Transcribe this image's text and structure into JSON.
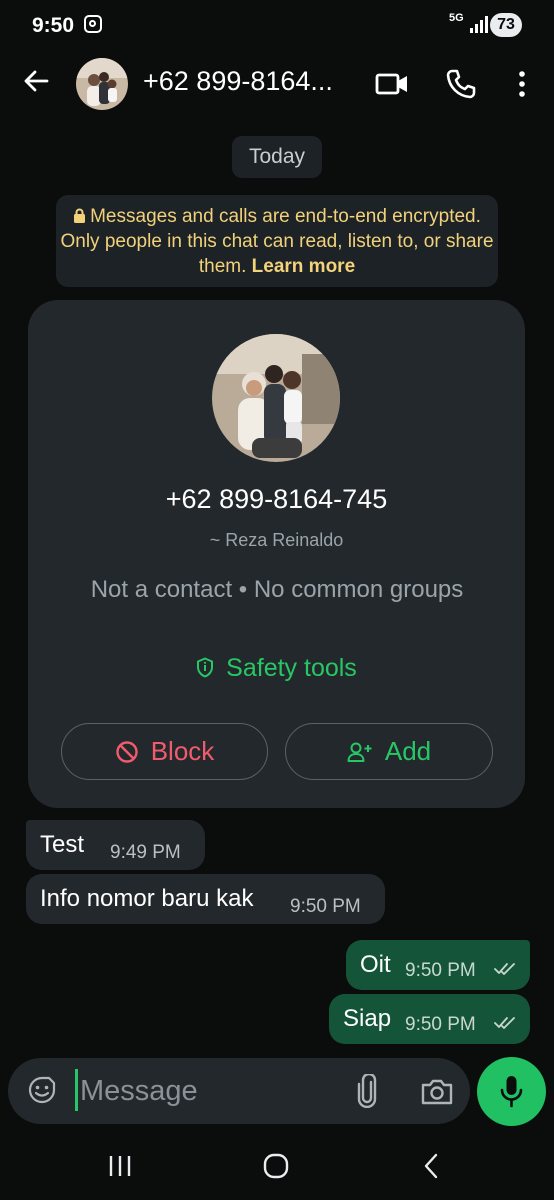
{
  "status_bar": {
    "time": "9:50",
    "network": "5G",
    "battery": "73"
  },
  "header": {
    "title": "+62 899-8164..."
  },
  "chat": {
    "date_chip": "Today",
    "encryption_notice": "Messages and calls are end-to-end encrypted. Only people in this chat can read, listen to, or share them.",
    "learn_more": "Learn more"
  },
  "contact_card": {
    "phone": "+62 899-8164-745",
    "name": "~ Reza Reinaldo",
    "info": "Not a contact • No common groups",
    "safety_tools": "Safety tools",
    "block_label": "Block",
    "add_label": "Add"
  },
  "messages": [
    {
      "direction": "incoming",
      "text": "Test",
      "time": "9:49 PM"
    },
    {
      "direction": "incoming",
      "text": "Info nomor baru kak",
      "time": "9:50 PM"
    },
    {
      "direction": "outgoing",
      "text": "Oit",
      "time": "9:50 PM",
      "status": "read"
    },
    {
      "direction": "outgoing",
      "text": "Siap",
      "time": "9:50 PM",
      "status": "read"
    }
  ],
  "composer": {
    "placeholder": "Message"
  },
  "colors": {
    "background": "#0b0c0c",
    "accent_green": "#21c063",
    "outgoing_bubble": "#14553a",
    "incoming_bubble": "#23282c",
    "block_red": "#f15c6d",
    "notice_yellow": "#f1d27a"
  },
  "icons": [
    "instagram-icon",
    "signal-icon",
    "back-arrow-icon",
    "video-call-icon",
    "phone-icon",
    "more-vert-icon",
    "lock-icon",
    "shield-icon",
    "block-icon",
    "add-person-icon",
    "double-check-icon",
    "emoji-icon",
    "attach-icon",
    "camera-icon",
    "mic-icon",
    "recents-icon",
    "home-icon",
    "back-nav-icon"
  ]
}
